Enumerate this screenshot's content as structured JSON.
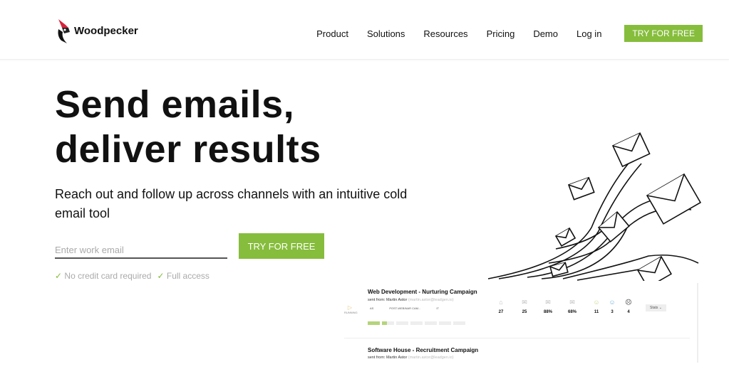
{
  "brand": {
    "name": "Woodpecker",
    "accent": "#86bd3c"
  },
  "nav": {
    "items": [
      "Product",
      "Solutions",
      "Resources",
      "Pricing",
      "Demo",
      "Log in"
    ],
    "cta": "TRY FOR FREE"
  },
  "hero": {
    "title_line1": "Send emails,",
    "title_line2": "deliver results",
    "subtitle": "Reach out and follow up across channels with an intuitive cold email tool",
    "email_placeholder": "Enter work email",
    "cta": "TRY FOR FREE",
    "checks": [
      "No credit card required",
      "Full access"
    ]
  },
  "dashboard": {
    "campaigns": [
      {
        "title": "Web Development - Nurturing Campaign",
        "sent_from": "sent from: Martin Astor",
        "email": "(martin.astor@leadgen.io)",
        "status": "RUNNING",
        "tags": [
          "AS",
          "POST-WEBINAR CAM...",
          "IT"
        ],
        "stats": [
          "27",
          "25",
          "88%",
          "68%",
          "11",
          "3",
          "4"
        ],
        "button": "Stats"
      },
      {
        "title": "Software House - Recruitment Campaign",
        "sent_from": "sent from: Martin Astor",
        "email": "(martin.astor@leadgen.io)"
      }
    ]
  }
}
